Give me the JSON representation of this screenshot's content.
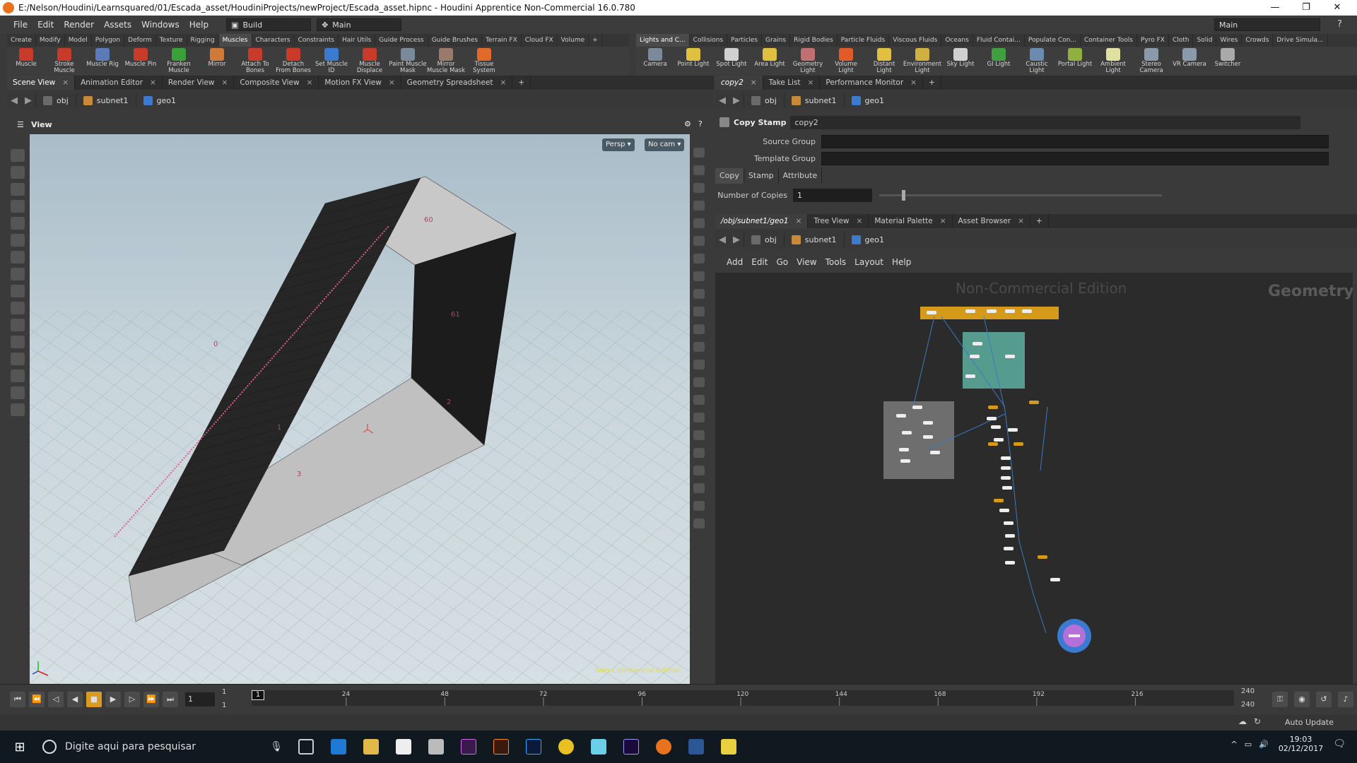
{
  "title": "E:/Nelson/Houdini/Learnsquared/01/Escada_asset/HoudiniProjects/newProject/Escada_asset.hipnc - Houdini Apprentice Non-Commercial 16.0.780",
  "window_controls": [
    "—",
    "❐",
    "✕"
  ],
  "menus": [
    "File",
    "Edit",
    "Render",
    "Assets",
    "Windows",
    "Help"
  ],
  "desktop": "Build",
  "main_label": "Main",
  "top_right_desktop": "Main",
  "shelf_tabs_left": [
    "Create",
    "Modify",
    "Model",
    "Polygon",
    "Deform",
    "Texture",
    "Rigging",
    "Muscles",
    "Characters",
    "Constraints",
    "Hair Utils",
    "Guide Process",
    "Guide Brushes",
    "Terrain FX",
    "Cloud FX",
    "Volume"
  ],
  "shelf_tabs_right": [
    "Lights and C...",
    "Collisions",
    "Particles",
    "Grains",
    "Rigid Bodies",
    "Particle Fluids",
    "Viscous Fluids",
    "Oceans",
    "Fluid Contai...",
    "Populate Con...",
    "Container Tools",
    "Pyro FX",
    "Cloth",
    "Solid",
    "Wires",
    "Crowds",
    "Drive Simula..."
  ],
  "tools_left": [
    {
      "label": "Muscle",
      "color": "#c83a2a"
    },
    {
      "label": "Stroke Muscle",
      "color": "#c83a2a"
    },
    {
      "label": "Muscle Rig",
      "color": "#5a7ab8"
    },
    {
      "label": "Muscle Pin",
      "color": "#c83a2a"
    },
    {
      "label": "Franken Muscle",
      "color": "#3aa03a"
    },
    {
      "label": "Mirror",
      "color": "#d07a3a"
    },
    {
      "label": "Attach To Bones",
      "color": "#c83a2a"
    },
    {
      "label": "Detach From Bones",
      "color": "#c83a2a"
    },
    {
      "label": "Set Muscle ID",
      "color": "#3a7ad0"
    },
    {
      "label": "Muscle Displace",
      "color": "#c83a2a"
    },
    {
      "label": "Paint Muscle Mask",
      "color": "#7a8a9a"
    },
    {
      "label": "Mirror Muscle Mask",
      "color": "#9a7a6a"
    },
    {
      "label": "Tissue System",
      "color": "#e06a2a"
    }
  ],
  "tools_right": [
    {
      "label": "Camera",
      "color": "#7a8a9a"
    },
    {
      "label": "Point Light",
      "color": "#e0c040"
    },
    {
      "label": "Spot Light",
      "color": "#d0d0d0"
    },
    {
      "label": "Area Light",
      "color": "#e0c040"
    },
    {
      "label": "Geometry Light",
      "color": "#c07070"
    },
    {
      "label": "Volume Light",
      "color": "#e05a2a"
    },
    {
      "label": "Distant Light",
      "color": "#e0c040"
    },
    {
      "label": "Environment Light",
      "color": "#d0b040"
    },
    {
      "label": "Sky Light",
      "color": "#d0d0d0"
    },
    {
      "label": "GI Light",
      "color": "#40a040"
    },
    {
      "label": "Caustic Light",
      "color": "#6a8ab0"
    },
    {
      "label": "Portal Light",
      "color": "#90b040"
    },
    {
      "label": "Ambient Light",
      "color": "#e0e0a0"
    },
    {
      "label": "Stereo Camera",
      "color": "#8a9aaa"
    },
    {
      "label": "VR Camera",
      "color": "#8a9aaa"
    },
    {
      "label": "Switcher",
      "color": "#aaaaaa"
    }
  ],
  "left_pane_tabs": [
    "Scene View",
    "Animation Editor",
    "Render View",
    "Composite View",
    "Motion FX View",
    "Geometry Spreadsheet"
  ],
  "path": {
    "obj": "obj",
    "subnet": "subnet1",
    "geo": "geo1"
  },
  "view_label": "View",
  "persp": "Persp ▾",
  "cam": "No cam ▾",
  "nc_watermark": "Non-Commercial Edition",
  "point_labels": [
    "60",
    "61",
    "2",
    "3",
    "0",
    "1"
  ],
  "right_top_tabs": [
    "copy2",
    "Take List",
    "Performance Monitor"
  ],
  "parm": {
    "node_type": "Copy Stamp",
    "node_name": "copy2",
    "source_group_label": "Source Group",
    "template_group_label": "Template Group",
    "tabs": [
      "Copy",
      "Stamp",
      "Attribute"
    ],
    "copies_label": "Number of Copies",
    "copies_value": "1"
  },
  "net_tabs": [
    "/obj/subnet1/geo1",
    "Tree View",
    "Material Palette",
    "Asset Browser"
  ],
  "net_menus": [
    "Add",
    "Edit",
    "Go",
    "View",
    "Tools",
    "Layout",
    "Help"
  ],
  "net_watermark": "Non-Commercial Edition",
  "net_context": "Geometry",
  "timeline": {
    "frame": "1",
    "start": "1",
    "start2": "1",
    "end": "240",
    "end2": "240",
    "ticks": [
      "24",
      "48",
      "72",
      "96",
      "120",
      "144",
      "168",
      "192",
      "216"
    ],
    "marker": "1",
    "auto_update": "Auto Update"
  },
  "taskbar": {
    "search": "Digite aqui para pesquisar",
    "time": "19:03",
    "date": "02/12/2017"
  }
}
